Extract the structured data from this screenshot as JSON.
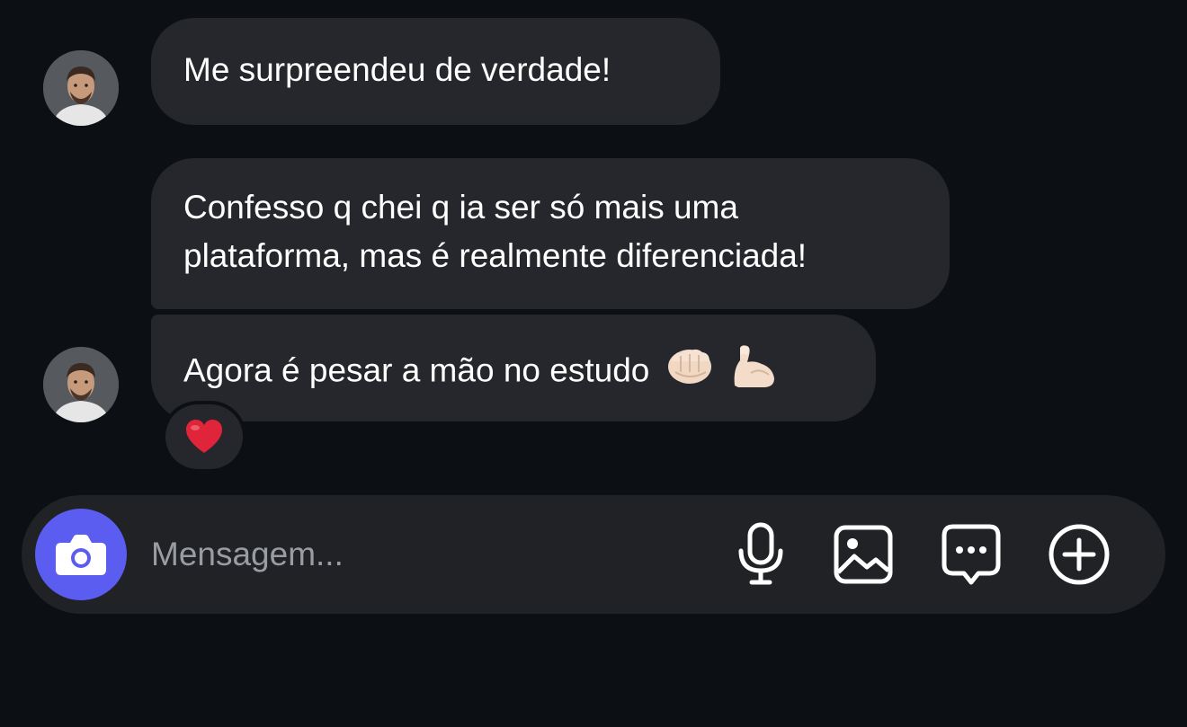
{
  "messages": [
    {
      "text": "Me surpreendeu de verdade!"
    },
    {
      "line1": "Confesso q chei q ia ser só mais uma",
      "line2": "plataforma, mas é realmente diferenciada!"
    },
    {
      "text": "Agora é pesar a mão no estudo",
      "emojis": [
        "oncoming-fist-icon",
        "flexed-biceps-icon"
      ],
      "reaction": "red-heart-icon"
    }
  ],
  "composer": {
    "placeholder": "Mensagem...",
    "icons": [
      "camera-icon",
      "microphone-icon",
      "image-icon",
      "chat-bubble-icon",
      "plus-circle-icon"
    ]
  },
  "colors": {
    "background": "#0c0f14",
    "bubble": "#25272c",
    "composer": "#202226",
    "camera_button": "#5b5cf0",
    "placeholder": "#9a9ca3"
  }
}
